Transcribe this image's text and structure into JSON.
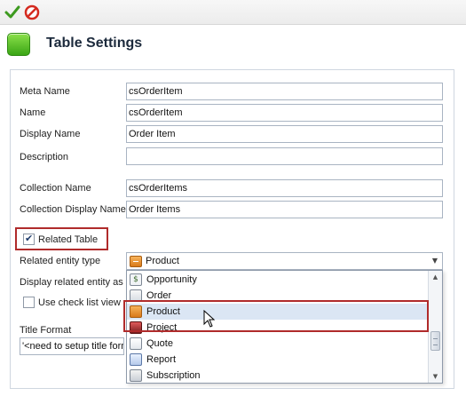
{
  "toolbar": {
    "confirm_icon": "check-icon",
    "cancel_icon": "cancel-icon"
  },
  "header": {
    "title": "Table Settings",
    "icon": "green-square-icon",
    "icon_color": "#3aa515"
  },
  "form": {
    "meta_name": {
      "label": "Meta Name",
      "value": "csOrderItem"
    },
    "name": {
      "label": "Name",
      "value": "csOrderItem"
    },
    "display_name": {
      "label": "Display Name",
      "value": "Order Item"
    },
    "description": {
      "label": "Description",
      "value": ""
    },
    "collection_name": {
      "label": "Collection Name",
      "value": "csOrderItems"
    },
    "collection_display_name": {
      "label": "Collection Display Name",
      "value": "Order Items"
    },
    "related_table": {
      "label": "Related Table",
      "checked": true
    },
    "related_entity_type": {
      "label": "Related entity type",
      "value": "Product"
    },
    "display_related_entity": {
      "label": "Display related entity as"
    },
    "use_check_list_view": {
      "label": "Use check list view",
      "checked": false
    },
    "title_format": {
      "label": "Title Format",
      "value": "'<need to setup title form"
    }
  },
  "dropdown": {
    "items": [
      {
        "label": "Opportunity",
        "icon": "opportunity-icon"
      },
      {
        "label": "Order",
        "icon": "order-icon"
      },
      {
        "label": "Product",
        "icon": "product-icon",
        "selected": true
      },
      {
        "label": "Project",
        "icon": "project-icon"
      },
      {
        "label": "Quote",
        "icon": "quote-icon"
      },
      {
        "label": "Report",
        "icon": "report-icon"
      },
      {
        "label": "Subscription",
        "icon": "subscription-icon"
      }
    ]
  },
  "colors": {
    "highlight_border": "#b02b2b",
    "selected_row": "#dbe6f4"
  }
}
